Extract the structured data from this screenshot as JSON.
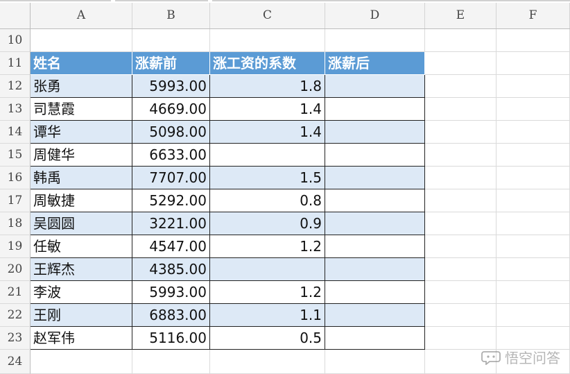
{
  "columns": [
    "A",
    "B",
    "C",
    "D",
    "E",
    "F"
  ],
  "rows": [
    {
      "num": "10",
      "cells": [
        "",
        "",
        "",
        ""
      ]
    },
    {
      "num": "11",
      "cells": [
        "姓名",
        "涨薪前",
        "涨工资的系数",
        "涨薪后"
      ]
    },
    {
      "num": "12",
      "cells": [
        "张勇",
        "5993.00",
        "1.8",
        ""
      ]
    },
    {
      "num": "13",
      "cells": [
        "司慧霞",
        "4669.00",
        "1.4",
        ""
      ]
    },
    {
      "num": "14",
      "cells": [
        "谭华",
        "5098.00",
        "1.4",
        ""
      ]
    },
    {
      "num": "15",
      "cells": [
        "周健华",
        "6633.00",
        "",
        ""
      ]
    },
    {
      "num": "16",
      "cells": [
        "韩禹",
        "7707.00",
        "1.5",
        ""
      ]
    },
    {
      "num": "17",
      "cells": [
        "周敏捷",
        "5292.00",
        "0.8",
        ""
      ]
    },
    {
      "num": "18",
      "cells": [
        "吴圆圆",
        "3221.00",
        "0.9",
        ""
      ]
    },
    {
      "num": "19",
      "cells": [
        "任敏",
        "4547.00",
        "1.2",
        ""
      ]
    },
    {
      "num": "20",
      "cells": [
        "王辉杰",
        "4385.00",
        "",
        ""
      ]
    },
    {
      "num": "21",
      "cells": [
        "李波",
        "5993.00",
        "1.2",
        ""
      ]
    },
    {
      "num": "22",
      "cells": [
        "王刚",
        "6883.00",
        "1.1",
        ""
      ]
    },
    {
      "num": "23",
      "cells": [
        "赵军伟",
        "5116.00",
        "0.5",
        ""
      ]
    },
    {
      "num": "24",
      "cells": [
        "",
        "",
        "",
        ""
      ]
    }
  ],
  "watermark": {
    "text": "悟空问答",
    "icon": "speech-bubble-icon"
  },
  "colors": {
    "header_fill": "#5b9bd5",
    "band_fill": "#dde9f6",
    "header_text": "#ffffff"
  }
}
